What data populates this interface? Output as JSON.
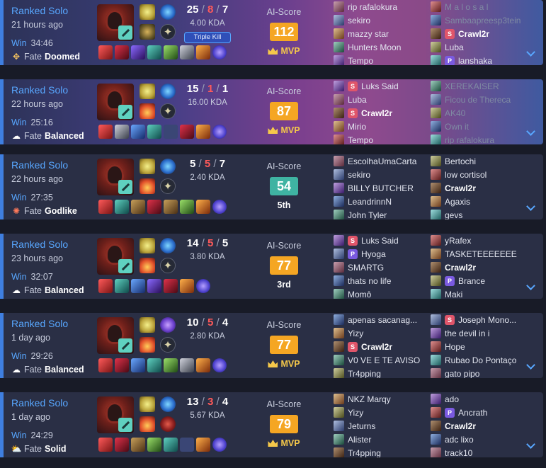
{
  "games": [
    {
      "queue": "Ranked Solo",
      "ago": "21 hours ago",
      "result": "Win",
      "duration": "34:46",
      "fate_label": "Fate",
      "fate": "Doomed",
      "fate_icon": "doomed-icon",
      "kills": "25",
      "deaths": "8",
      "assists": "7",
      "kda": "4.00 KDA",
      "badge": "Triple Kill",
      "score_label": "AI-Score",
      "score": "112",
      "placement": "MVP",
      "score_color": "orange",
      "team1": [
        {
          "name": "rip rafalokura"
        },
        {
          "name": "sekiro"
        },
        {
          "name": "mazzy star"
        },
        {
          "name": "Hunters Moon"
        },
        {
          "name": "Tempo"
        }
      ],
      "team2": [
        {
          "name": "M a l o s a l"
        },
        {
          "name": "Sambaapreesp3tein"
        },
        {
          "name": "Crawl2r",
          "tag": "S",
          "me": true
        },
        {
          "name": "Luba"
        },
        {
          "name": "lanshaka",
          "tag": "P"
        }
      ]
    },
    {
      "queue": "Ranked Solo",
      "ago": "22 hours ago",
      "result": "Win",
      "duration": "25:16",
      "fate_label": "Fate",
      "fate": "Balanced",
      "fate_icon": "cloud-icon",
      "kills": "15",
      "deaths": "1",
      "assists": "1",
      "kda": "16.00 KDA",
      "badge": "",
      "score_label": "AI-Score",
      "score": "87",
      "placement": "MVP",
      "score_color": "orange",
      "team1": [
        {
          "name": "Luks Said",
          "tag": "S"
        },
        {
          "name": "Luba"
        },
        {
          "name": "Crawl2r",
          "tag": "S",
          "me": true
        },
        {
          "name": "Mirio"
        },
        {
          "name": "Tempo"
        }
      ],
      "team2": [
        {
          "name": "XEREKAISER"
        },
        {
          "name": "Ficou de Thereca"
        },
        {
          "name": "AK40"
        },
        {
          "name": "Own it"
        },
        {
          "name": "rip rafalokura"
        }
      ]
    },
    {
      "queue": "Ranked Solo",
      "ago": "22 hours ago",
      "result": "Win",
      "duration": "27:35",
      "fate_label": "Fate",
      "fate": "Godlike",
      "fate_icon": "godlike-icon",
      "kills": "5",
      "deaths": "5",
      "assists": "7",
      "kda": "2.40 KDA",
      "badge": "",
      "score_label": "AI-Score",
      "score": "54",
      "placement": "5th",
      "score_color": "teal",
      "team1": [
        {
          "name": "EscolhaUmaCarta"
        },
        {
          "name": "sekiro"
        },
        {
          "name": "BILLY BUTCHER"
        },
        {
          "name": "LeandrinnN"
        },
        {
          "name": "John Tyler"
        }
      ],
      "team2": [
        {
          "name": "Bertochi"
        },
        {
          "name": "low cortisol"
        },
        {
          "name": "Crawl2r",
          "me": true
        },
        {
          "name": "Agaxis"
        },
        {
          "name": "gevs"
        }
      ]
    },
    {
      "queue": "Ranked Solo",
      "ago": "23 hours ago",
      "result": "Win",
      "duration": "32:07",
      "fate_label": "Fate",
      "fate": "Balanced",
      "fate_icon": "cloud-icon",
      "kills": "14",
      "deaths": "5",
      "assists": "5",
      "kda": "3.80 KDA",
      "badge": "",
      "score_label": "AI-Score",
      "score": "77",
      "placement": "3rd",
      "score_color": "orange",
      "team1": [
        {
          "name": "Luks Said",
          "tag": "S"
        },
        {
          "name": "Hyoga",
          "tag": "P"
        },
        {
          "name": "SMARTG"
        },
        {
          "name": "thats no life"
        },
        {
          "name": "Momô"
        }
      ],
      "team2": [
        {
          "name": "yRafex"
        },
        {
          "name": "TASKETEEEEEEE"
        },
        {
          "name": "Crawl2r",
          "me": true
        },
        {
          "name": "Brance",
          "tag": "P"
        },
        {
          "name": "Maki"
        }
      ]
    },
    {
      "queue": "Ranked Solo",
      "ago": "1 day ago",
      "result": "Win",
      "duration": "29:26",
      "fate_label": "Fate",
      "fate": "Balanced",
      "fate_icon": "cloud-icon",
      "kills": "10",
      "deaths": "5",
      "assists": "4",
      "kda": "2.80 KDA",
      "badge": "",
      "score_label": "AI-Score",
      "score": "77",
      "placement": "MVP",
      "score_color": "orange",
      "team1": [
        {
          "name": "apenas sacanag..."
        },
        {
          "name": "Yizy"
        },
        {
          "name": "Crawl2r",
          "tag": "S",
          "me": true
        },
        {
          "name": "V0 VE E TE AVISO"
        },
        {
          "name": "Tr4pping"
        }
      ],
      "team2": [
        {
          "name": "Joseph Mono...",
          "tag": "S"
        },
        {
          "name": "the devil in i"
        },
        {
          "name": "Hope"
        },
        {
          "name": "Rubao Do Pontaço"
        },
        {
          "name": "gato pipo"
        }
      ]
    },
    {
      "queue": "Ranked Solo",
      "ago": "1 day ago",
      "result": "Win",
      "duration": "24:29",
      "fate_label": "Fate",
      "fate": "Solid",
      "fate_icon": "sun-cloud-icon",
      "kills": "13",
      "deaths": "3",
      "assists": "4",
      "kda": "5.67 KDA",
      "badge": "",
      "score_label": "AI-Score",
      "score": "79",
      "placement": "MVP",
      "score_color": "orange",
      "team1": [
        {
          "name": "NKZ Marqy"
        },
        {
          "name": "Yizy"
        },
        {
          "name": "Jeturns"
        },
        {
          "name": "Alister"
        },
        {
          "name": "Tr4pping"
        }
      ],
      "team2": [
        {
          "name": "ado"
        },
        {
          "name": "Ancrath",
          "tag": "P"
        },
        {
          "name": "Crawl2r",
          "me": true
        },
        {
          "name": "adc lixo"
        },
        {
          "name": "track10"
        }
      ]
    }
  ]
}
